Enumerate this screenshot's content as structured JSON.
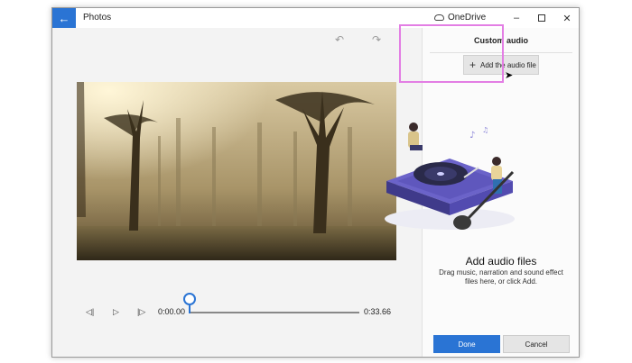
{
  "window": {
    "title": "Photos",
    "back_icon": "back-arrow-icon",
    "onedrive_label": "OneDrive",
    "controls": {
      "minimize": "–",
      "close": "✕"
    }
  },
  "editor": {
    "undo_icon": "undo-icon",
    "redo_icon": "redo-icon",
    "playback": {
      "prev_glyph": "◁|",
      "play_glyph": "▷",
      "next_glyph": "|▷",
      "current_time": "0:00.00",
      "total_time": "0:33.66",
      "progress": 0
    }
  },
  "panel": {
    "title": "Custom audio",
    "add_button_label": "Add the audio file",
    "heading": "Add audio files",
    "description": "Drag music, narration and sound effect files here, or click Add.",
    "done_label": "Done",
    "cancel_label": "Cancel"
  },
  "colors": {
    "accent": "#2a74d4",
    "highlight": "#e37ee4"
  }
}
